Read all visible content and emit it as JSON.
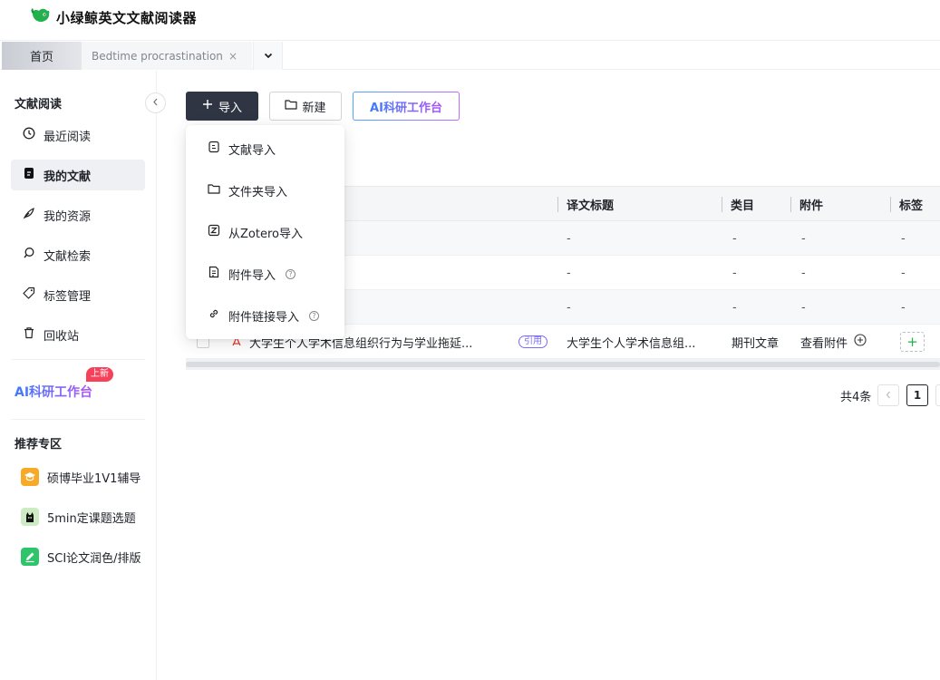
{
  "app": {
    "title": "小绿鲸英文文献阅读器",
    "brand_color": "#22b14c"
  },
  "tabs": {
    "home_label": "首页",
    "doc_label": "Bedtime procrastination: ...",
    "doc_close": "×"
  },
  "sidebar": {
    "section_reading": "文献阅读",
    "items": [
      {
        "label": "最近阅读",
        "icon": "clock-icon"
      },
      {
        "label": "我的文献",
        "icon": "document-icon",
        "active": true
      },
      {
        "label": "我的资源",
        "icon": "feather-icon"
      },
      {
        "label": "文献检索",
        "icon": "search-icon"
      },
      {
        "label": "标签管理",
        "icon": "tag-icon"
      },
      {
        "label": "回收站",
        "icon": "trash-icon"
      }
    ],
    "ai_link": "AI科研工作台",
    "new_badge": "上新",
    "section_recommend": "推荐专区",
    "recommend": [
      {
        "label": "硕博毕业1V1辅导",
        "icon": "graduation-cap-icon"
      },
      {
        "label": "5min定课题选题",
        "icon": "cat-logo-icon"
      },
      {
        "label": "SCI论文润色/排版",
        "icon": "edit-icon"
      }
    ]
  },
  "toolbar": {
    "import_label": "导入",
    "new_label": "新建",
    "ai_label": "AI科研工作台"
  },
  "import_menu": [
    {
      "label": "文献导入",
      "icon": "file-icon",
      "help": false
    },
    {
      "label": "文件夹导入",
      "icon": "folder-icon",
      "help": false
    },
    {
      "label": "从Zotero导入",
      "icon": "zotero-icon",
      "help": true
    },
    {
      "label": "附件导入",
      "icon": "attachment-icon",
      "help": true
    },
    {
      "label": "附件链接导入",
      "icon": "link-icon",
      "help": true
    }
  ],
  "table": {
    "columns": {
      "translated_title": "译文标题",
      "category": "类目",
      "attachment": "附件",
      "tags": "标签"
    },
    "rows": [
      {
        "title": "",
        "translated_title": "-",
        "category": "-",
        "attachment": "-",
        "tags": "-"
      },
      {
        "title": "",
        "translated_title": "-",
        "category": "-",
        "attachment": "-",
        "tags": "-"
      },
      {
        "title": "",
        "translated_title": "-",
        "category": "-",
        "attachment": "-",
        "tags": "-"
      },
      {
        "title": "大学生个人学术信息组织行为与学业拖延...",
        "cite": "引用",
        "translated_title": "大学生个人学术信息组...",
        "category": "期刊文章",
        "attachment": "查看附件",
        "tags": "+"
      }
    ]
  },
  "pagination": {
    "total": "共4条",
    "current": "1"
  }
}
